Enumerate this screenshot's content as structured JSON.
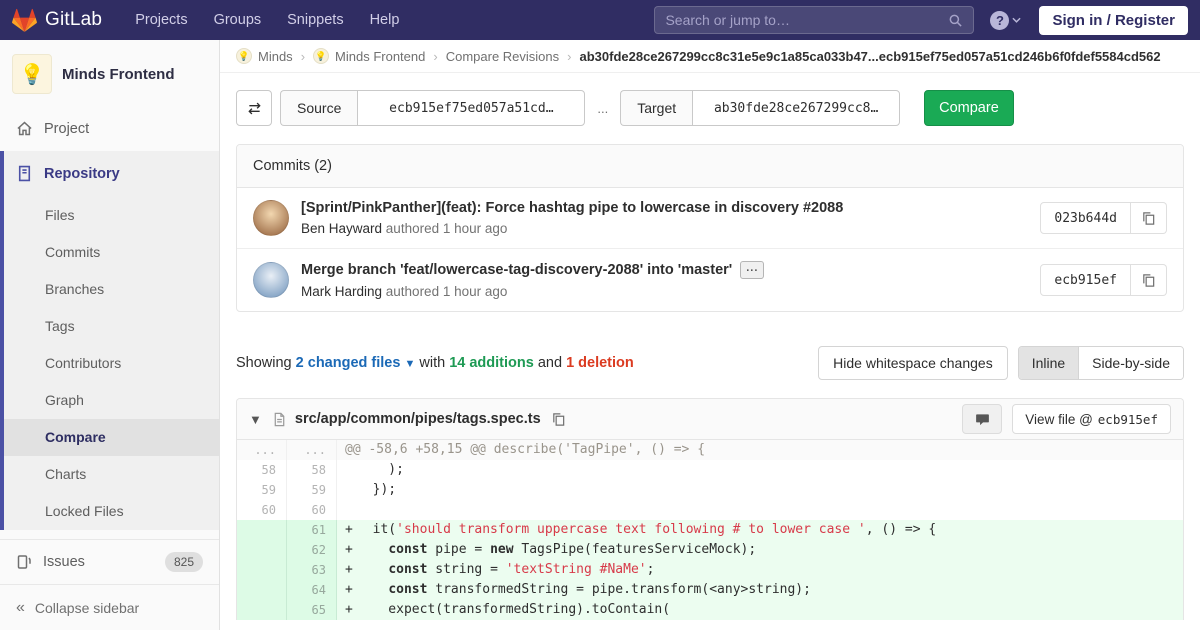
{
  "navbar": {
    "brand": "GitLab",
    "links": [
      "Projects",
      "Groups",
      "Snippets",
      "Help"
    ],
    "search_placeholder": "Search or jump to…",
    "help_glyph": "?",
    "sign_in_label": "Sign in / Register"
  },
  "sidebar": {
    "project_name": "Minds Frontend",
    "project_avatar_emoji": "💡",
    "project_item": "Project",
    "repository_item": "Repository",
    "repository_children": [
      {
        "label": "Files"
      },
      {
        "label": "Commits"
      },
      {
        "label": "Branches"
      },
      {
        "label": "Tags"
      },
      {
        "label": "Contributors"
      },
      {
        "label": "Graph"
      },
      {
        "label": "Compare",
        "active": true
      },
      {
        "label": "Charts"
      },
      {
        "label": "Locked Files"
      }
    ],
    "issues_label": "Issues",
    "issues_count": "825",
    "collapse_glyph": "«",
    "collapse_label": "Collapse sidebar"
  },
  "breadcrumb": {
    "links": [
      {
        "label": "Minds",
        "avatar": "💡"
      },
      {
        "label": "Minds Frontend",
        "avatar": "💡"
      },
      {
        "label": "Compare Revisions"
      }
    ],
    "separator": "›",
    "current": "ab30fde28ce267299cc8c31e5e9c1a85ca033b47...ecb915ef75ed057a51cd246b6f0fdef5584cd562"
  },
  "compare_form": {
    "source_label": "Source",
    "source_value": "ecb915ef75ed057a51cd…",
    "separator": "...",
    "target_label": "Target",
    "target_value": "ab30fde28ce267299cc8…",
    "compare_label": "Compare"
  },
  "commits_panel": {
    "header": "Commits (2)",
    "commits": [
      {
        "title": "[Sprint/PinkPanther](feat): Force hashtag pipe to lowercase in discovery #2088",
        "author": "Ben Hayward",
        "meta": "authored 1 hour ago",
        "sha": "023b644d",
        "avatar_colors": [
          "#f2d7b0",
          "#9c6b45"
        ]
      },
      {
        "title": "Merge branch 'feat/lowercase-tag-discovery-2088' into 'master'",
        "expand": "...",
        "author": "Mark Harding",
        "meta": "authored 1 hour ago",
        "sha": "ecb915ef",
        "avatar_colors": [
          "#e9eff6",
          "#7a9cc0"
        ]
      }
    ]
  },
  "diff_summary": {
    "showing": "Showing",
    "changed_files": "2 changed files",
    "with_word": "with",
    "additions": "14 additions",
    "and_word": "and",
    "deletions": "1 deletion",
    "hide_whitespace": "Hide whitespace changes",
    "inline": "Inline",
    "side_by_side": "Side-by-side"
  },
  "file_diff": {
    "path": "src/app/common/pipes/tags.spec.ts",
    "view_file_prefix": "View file @",
    "view_file_sha": "ecb915ef",
    "lines": [
      {
        "type": "hunk",
        "old": "...",
        "new": "...",
        "segments": [
          {
            "text": "@@ -58,6 +58,15 @@ describe('TagPipe', () => {"
          }
        ]
      },
      {
        "type": "context",
        "old": "58",
        "new": "58",
        "sign": "",
        "segments": [
          {
            "text": "    );"
          }
        ]
      },
      {
        "type": "context",
        "old": "59",
        "new": "59",
        "sign": "",
        "segments": [
          {
            "text": "  });"
          }
        ]
      },
      {
        "type": "context",
        "old": "60",
        "new": "60",
        "sign": "",
        "segments": [
          {
            "text": ""
          }
        ]
      },
      {
        "type": "added",
        "old": "",
        "new": "61",
        "sign": "+",
        "segments": [
          {
            "text": "  it("
          },
          {
            "text": "'should transform uppercase text following # to lower case '",
            "style": "string"
          },
          {
            "text": ", () => {"
          }
        ]
      },
      {
        "type": "added",
        "old": "",
        "new": "62",
        "sign": "+",
        "segments": [
          {
            "text": "    "
          },
          {
            "text": "const",
            "style": "keyword"
          },
          {
            "text": " pipe = "
          },
          {
            "text": "new",
            "style": "keyword"
          },
          {
            "text": " TagsPipe(featuresServiceMock);"
          }
        ]
      },
      {
        "type": "added",
        "old": "",
        "new": "63",
        "sign": "+",
        "segments": [
          {
            "text": "    "
          },
          {
            "text": "const",
            "style": "keyword"
          },
          {
            "text": " string = "
          },
          {
            "text": "'textString #NaMe'",
            "style": "string"
          },
          {
            "text": ";"
          }
        ]
      },
      {
        "type": "added",
        "old": "",
        "new": "64",
        "sign": "+",
        "segments": [
          {
            "text": "    "
          },
          {
            "text": "const",
            "style": "keyword"
          },
          {
            "text": " transformedString = pipe.transform(<any>string);"
          }
        ]
      },
      {
        "type": "added",
        "old": "",
        "new": "65",
        "sign": "+",
        "segments": [
          {
            "text": "    expect(transformedString).toContain("
          }
        ]
      }
    ]
  },
  "colors": {
    "navbar_bg": "#302d63",
    "button_green": "#1aaa55",
    "link_blue": "#1b69b6",
    "additions_green": "#1e9a54",
    "deletions_red": "#db3b21",
    "added_line_bg": "#ecfdf0",
    "added_gutter_bg": "#ddfbe6",
    "string_red": "#d73a49",
    "sidebar_active_indigo": "#4b51a5"
  }
}
